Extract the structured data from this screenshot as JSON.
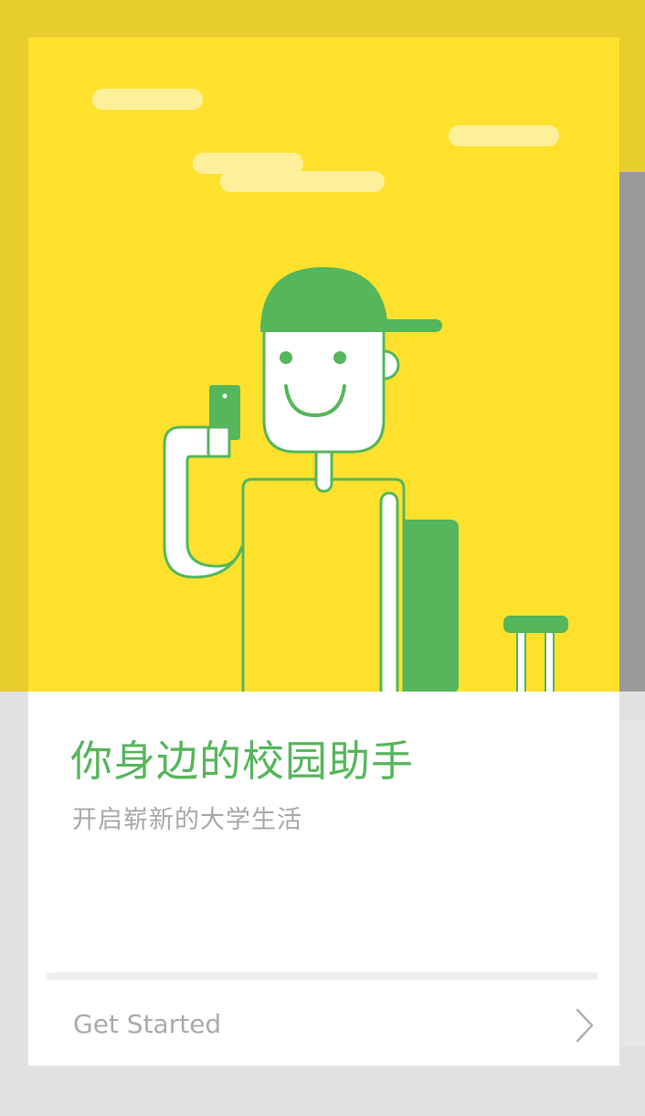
{
  "intro": {
    "title": "你身边的校园助手",
    "subtitle": "开启崭新的大学生活"
  },
  "action": {
    "label": "Get Started",
    "icon": "chevron-right-icon"
  },
  "colors": {
    "hero_yellow": "#fee12d",
    "frame_yellow": "#e7cd2e",
    "accent_green": "#56b65b",
    "subtitle_gray": "#a8a8a8",
    "button_gray": "#ababab",
    "cloud": "#fef09a"
  }
}
